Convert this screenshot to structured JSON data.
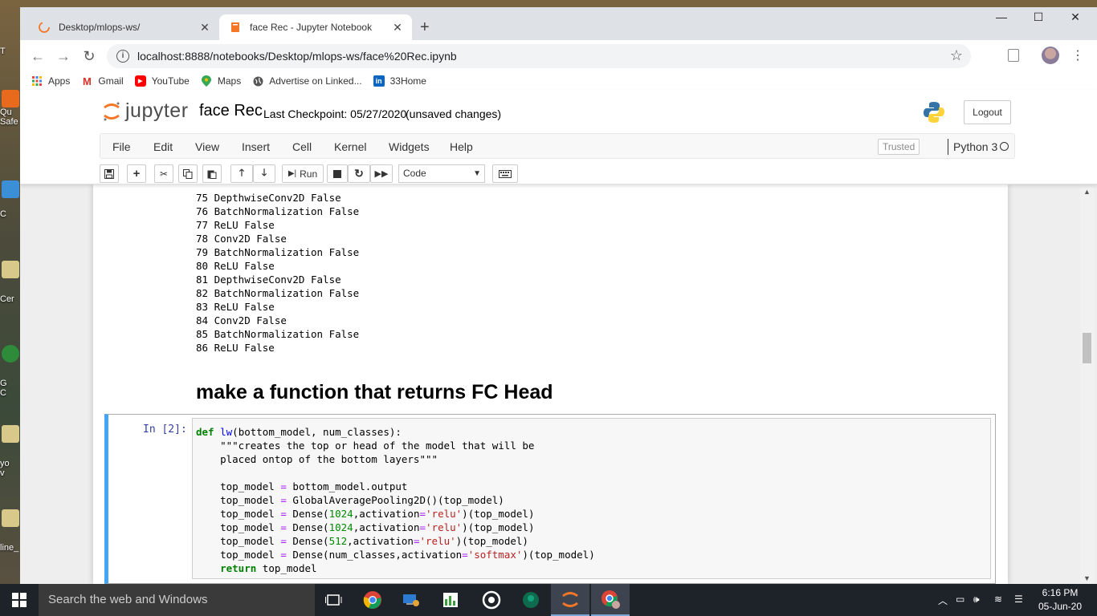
{
  "browser": {
    "tabs": [
      {
        "title": "Desktop/mlops-ws/",
        "close": "✕",
        "active": false
      },
      {
        "title": "face Rec - Jupyter Notebook",
        "close": "✕",
        "active": true
      }
    ],
    "new_tab": "+",
    "window_controls": {
      "minimize": "—",
      "maximize": "☐",
      "close": "✕"
    },
    "url": "localhost:8888/notebooks/Desktop/mlops-ws/face%20Rec.ipynb",
    "bookmarks": [
      "Apps",
      "Gmail",
      "YouTube",
      "Maps",
      "Advertise on Linked...",
      "33Home"
    ]
  },
  "jupyter": {
    "logo_text": "jupyter",
    "notebook_name": "face Rec",
    "checkpoint": "Last Checkpoint: 05/27/2020",
    "unsaved": "(unsaved changes)",
    "logout": "Logout",
    "menu": [
      "File",
      "Edit",
      "View",
      "Insert",
      "Cell",
      "Kernel",
      "Widgets",
      "Help"
    ],
    "trusted": "Trusted",
    "kernel": "Python 3",
    "toolbar": {
      "run": "Run",
      "cell_type": "Code"
    }
  },
  "output_lines": [
    "75 DepthwiseConv2D False",
    "76 BatchNormalization False",
    "77 ReLU False",
    "78 Conv2D False",
    "79 BatchNormalization False",
    "80 ReLU False",
    "81 DepthwiseConv2D False",
    "82 BatchNormalization False",
    "83 ReLU False",
    "84 Conv2D False",
    "85 BatchNormalization False",
    "86 ReLU False"
  ],
  "markdown_heading": "make a function that returns FC Head",
  "cell": {
    "prompt": "In [2]:",
    "code": {
      "l1_kw": "def",
      "l1_fn": "lw",
      "l1_rest": "(bottom_model, num_classes):",
      "l2": "    \"\"\"creates the top or head of the model that will be",
      "l3": "    placed ontop of the bottom layers\"\"\"",
      "l5_a": "    top_model ",
      "l5_op": "=",
      "l5_b": " bottom_model.output",
      "l6_a": "    top_model ",
      "l6_op": "=",
      "l6_b": " GlobalAveragePooling2D()(top_model)",
      "l7_a": "    top_model ",
      "l7_op": "=",
      "l7_b": " Dense(",
      "l7_num": "1024",
      "l7_c": ",activation",
      "l7_op2": "=",
      "l7_str": "'relu'",
      "l7_d": ")(top_model)",
      "l8_a": "    top_model ",
      "l8_op": "=",
      "l8_b": " Dense(",
      "l8_num": "1024",
      "l8_c": ",activation",
      "l8_op2": "=",
      "l8_str": "'relu'",
      "l8_d": ")(top_model)",
      "l9_a": "    top_model ",
      "l9_op": "=",
      "l9_b": " Dense(",
      "l9_num": "512",
      "l9_c": ",activation",
      "l9_op2": "=",
      "l9_str": "'relu'",
      "l9_d": ")(top_model)",
      "l10_a": "    top_model ",
      "l10_op": "=",
      "l10_b": " Dense(num_classes,activation",
      "l10_op2": "=",
      "l10_str": "'softmax'",
      "l10_d": ")(top_model)",
      "l11_kw": "    return",
      "l11_rest": " top_model"
    }
  },
  "taskbar": {
    "search_placeholder": "Search the web and Windows",
    "time": "6:16 PM",
    "date": "05-Jun-20"
  },
  "desktop_labels": [
    "T",
    "Qu",
    "Safe",
    "C",
    "Cer",
    "G",
    "C",
    "yo",
    "v",
    "line_"
  ]
}
